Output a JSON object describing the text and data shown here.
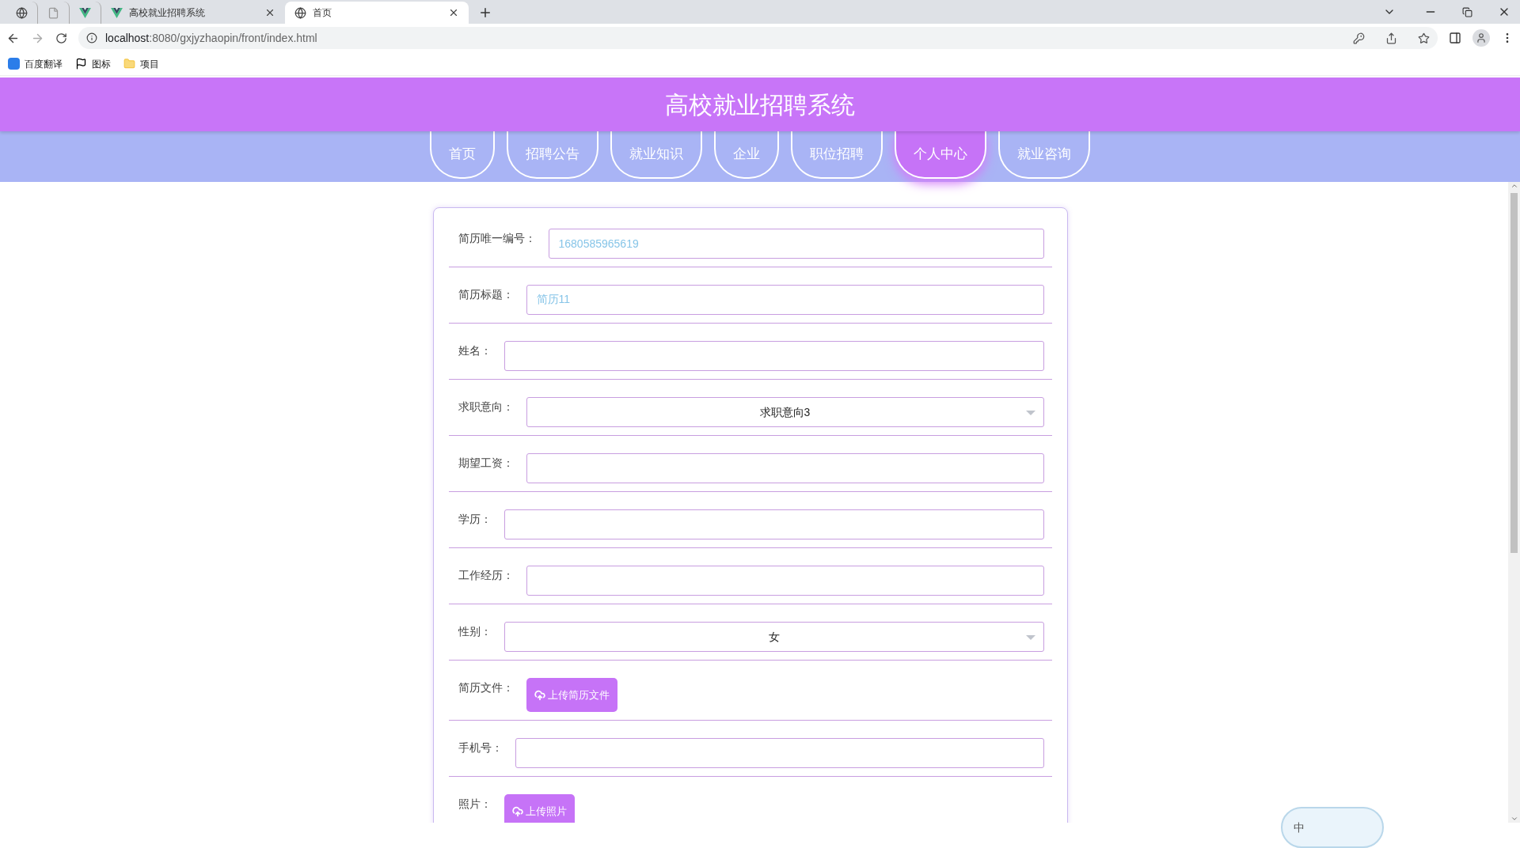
{
  "browser": {
    "tabs": [
      {
        "kind": "globe",
        "selected": false
      },
      {
        "kind": "page",
        "selected": false
      },
      {
        "kind": "vue",
        "selected": false
      },
      {
        "kind": "vue",
        "title": "高校就业招聘系统",
        "selected": false
      },
      {
        "kind": "globe",
        "title": "首页",
        "selected": true
      }
    ],
    "url_host": "localhost",
    "url_rest": ":8080/gxjyzhaopin/front/index.html",
    "bookmarks": [
      {
        "kind": "translate",
        "label": "百度翻译"
      },
      {
        "kind": "flag",
        "label": "图标"
      },
      {
        "kind": "folder",
        "label": "项目"
      }
    ]
  },
  "site_title": "高校就业招聘系统",
  "nav": [
    {
      "label": "首页",
      "selected": false
    },
    {
      "label": "招聘公告",
      "selected": false
    },
    {
      "label": "就业知识",
      "selected": false
    },
    {
      "label": "企业",
      "selected": false
    },
    {
      "label": "职位招聘",
      "selected": false
    },
    {
      "label": "个人中心",
      "selected": true
    },
    {
      "label": "就业咨询",
      "selected": false
    }
  ],
  "form": [
    {
      "label": "简历唯一编号：",
      "kind": "input",
      "value": "1680585965619"
    },
    {
      "label": "简历标题：",
      "kind": "input",
      "value": "简历11"
    },
    {
      "label": "姓名：",
      "kind": "input"
    },
    {
      "label": "求职意向：",
      "kind": "select",
      "value": "求职意向3"
    },
    {
      "label": "期望工资：",
      "kind": "input"
    },
    {
      "label": "学历：",
      "kind": "input"
    },
    {
      "label": "工作经历：",
      "kind": "input"
    },
    {
      "label": "性别：",
      "kind": "select",
      "value": "女"
    },
    {
      "label": "简历文件：",
      "kind": "upload",
      "button": "上传简历文件"
    },
    {
      "label": "手机号：",
      "kind": "input"
    },
    {
      "label": "照片：",
      "kind": "upload",
      "button": "上传照片"
    }
  ],
  "ime": {
    "label": "中"
  }
}
